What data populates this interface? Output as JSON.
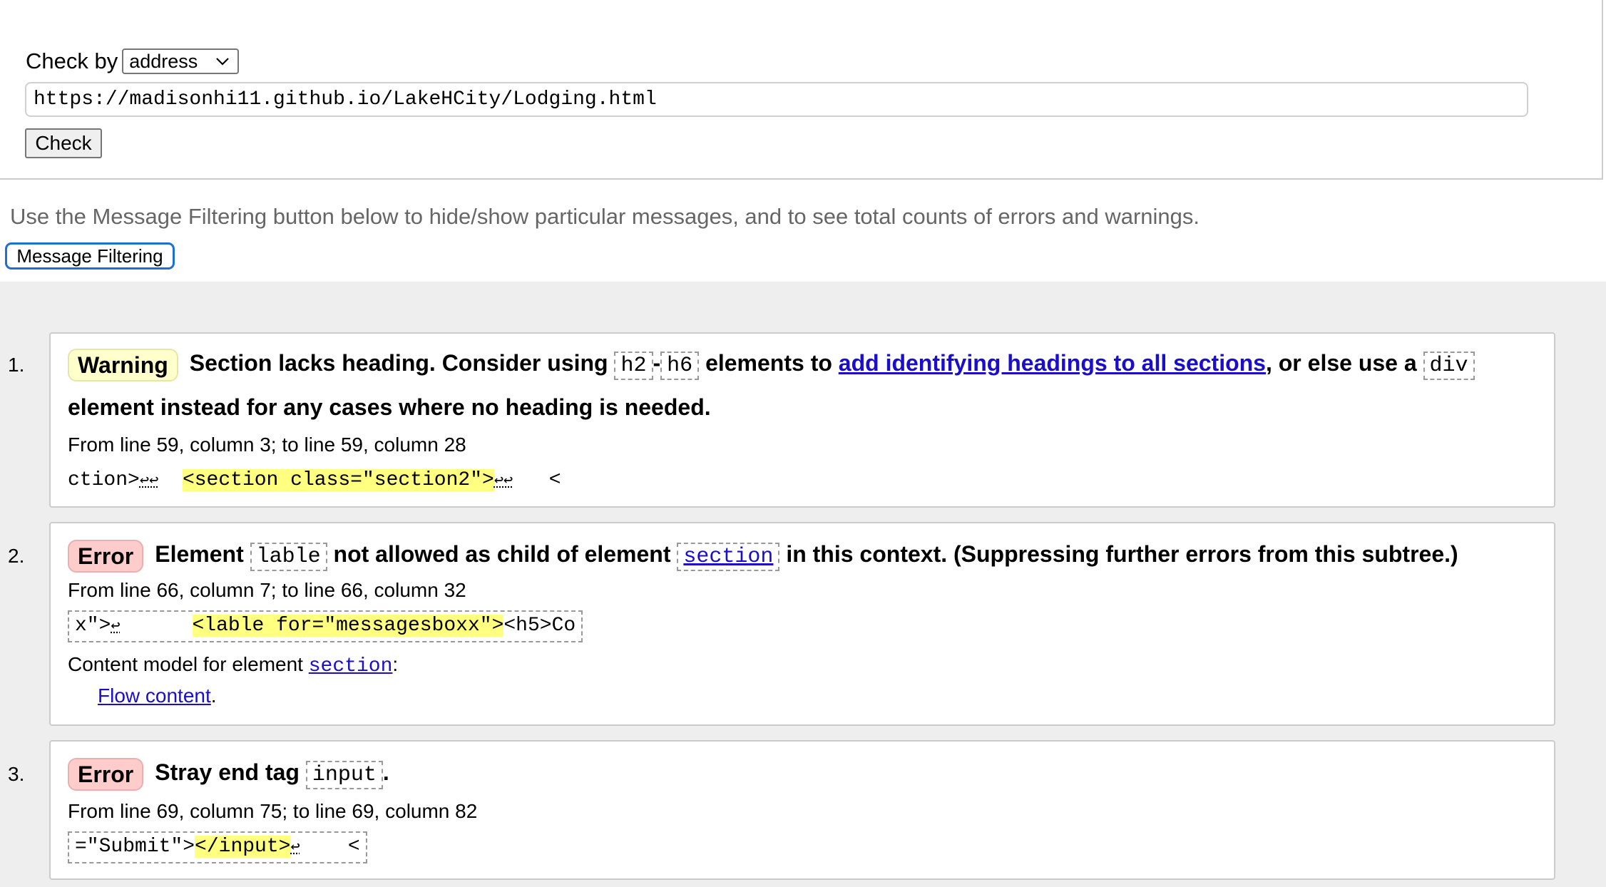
{
  "form": {
    "check_by_label": "Check by",
    "check_by_value": "address",
    "url_value": "https://madisonhi11.github.io/LakeHCity/Lodging.html",
    "check_button": "Check"
  },
  "filter": {
    "hint": "Use the Message Filtering button below to hide/show particular messages, and to see total counts of errors and warnings.",
    "button_label": "Message Filtering"
  },
  "messages": [
    {
      "number": "1.",
      "type": "Warning",
      "text_1": "Section lacks heading. Consider using",
      "code_1": "h2",
      "sep": "-",
      "code_2": "h6",
      "text_2": "elements to",
      "link": "add identifying headings to all sections",
      "text_3": ", or else use a",
      "code_3": "div",
      "text_4": "element instead for any cases where no heading is needed.",
      "location": "From line 59, column 3; to line 59, column 28",
      "extract_pre": "ction>",
      "extract_lf1": "↩↩",
      "extract_gap": "  ",
      "extract_hl": "<section class=\"section2\">",
      "extract_lf2": "↩↩",
      "extract_post": "   <"
    },
    {
      "number": "2.",
      "type": "Error",
      "text_1": "Element",
      "code_1": "lable",
      "text_2": "not allowed as child of element",
      "code_2_link": "section",
      "text_3": "in this context. (Suppressing further errors from this subtree.)",
      "location": "From line 66, column 7; to line 66, column 32",
      "extract_pre": "x\">",
      "extract_lf1": "↩",
      "extract_gap": "      ",
      "extract_hl": "<lable for=\"messagesboxx\">",
      "extract_post": "<h5>Co",
      "content_model_label": "Content model for element",
      "content_model_code": "section",
      "content_model_colon": ":",
      "flow_link": "Flow content",
      "flow_period": "."
    },
    {
      "number": "3.",
      "type": "Error",
      "text_1": "Stray end tag",
      "code_1": "input",
      "text_2": ".",
      "location": "From line 69, column 75; to line 69, column 82",
      "extract_pre": "=\"Submit\">",
      "extract_hl": "</input>",
      "extract_lf1": "↩",
      "extract_post": "    <"
    }
  ]
}
